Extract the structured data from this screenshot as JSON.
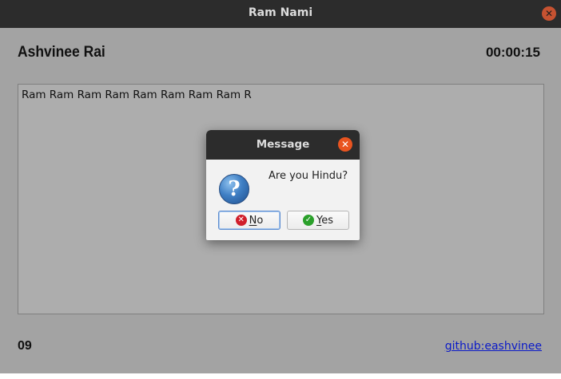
{
  "window": {
    "title": "Ram Nami"
  },
  "header": {
    "user_name": "Ashvinee Rai",
    "timer": "00:00:15"
  },
  "editor": {
    "text": "Ram Ram Ram Ram Ram Ram Ram Ram R"
  },
  "footer": {
    "count": "09",
    "link_text": "github:eashvinee"
  },
  "dialog": {
    "title": "Message",
    "message": "Are you Hindu?",
    "no_label_mnemonic": "N",
    "no_label_rest": "o",
    "yes_label_mnemonic": "Y",
    "yes_label_rest": "es"
  },
  "icons": {
    "window_close": "close-icon",
    "dialog_close": "close-icon",
    "question": "question-icon",
    "no": "cancel-circle-icon",
    "yes": "check-circle-icon"
  },
  "colors": {
    "titlebar": "#2c2c2c",
    "window_bg": "#a3a3a3",
    "close_accent": "#e95420",
    "link": "#0b1ac8"
  }
}
